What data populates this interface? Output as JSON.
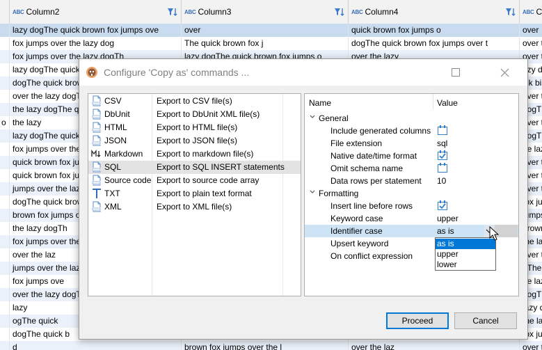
{
  "grid": {
    "columns": [
      {
        "name": "Column2",
        "type_badge": "ABC"
      },
      {
        "name": "Column3",
        "type_badge": "ABC"
      },
      {
        "name": "Column4",
        "type_badge": "ABC"
      },
      {
        "name": "C",
        "type_badge": "ABC"
      }
    ],
    "rows": [
      {
        "num": "",
        "c2": "lazy dogThe quick brown fox jumps ove",
        "c3": "over",
        "c4": "quick brown fox jumps o",
        "c5": "over"
      },
      {
        "num": "",
        "c2": "fox jumps over the lazy dog",
        "c3": "The quick brown fox j",
        "c4": "dogThe quick brown fox jumps over t",
        "c5": "over t"
      },
      {
        "num": "",
        "c2": "fox jumps over the lazy dogTh",
        "c3": "lazy dogThe quick brown fox jumps o",
        "c4": "over the lazy",
        "c5": "over t"
      },
      {
        "num": "",
        "c2": "lazy dogThe quick",
        "c3": "",
        "c4": "",
        "c5": "azy d"
      },
      {
        "num": "",
        "c2": "dogThe quick brow",
        "c3": "",
        "c4": "",
        "c5": "ick bi"
      },
      {
        "num": "",
        "c2": "over the lazy dogT",
        "c3": "",
        "c4": "",
        "c5": "over t"
      },
      {
        "num": "",
        "c2": "the lazy dogThe qu",
        "c3": "",
        "c4": "",
        "c5": "dogTh"
      },
      {
        "num": "o",
        "c2": "the lazy",
        "c3": "",
        "c4": "",
        "c5": "over t"
      },
      {
        "num": "",
        "c2": "lazy dogThe quick",
        "c3": "",
        "c4": "",
        "c5": "dogTh"
      },
      {
        "num": "",
        "c2": "fox jumps over the",
        "c3": "",
        "c4": "",
        "c5": "he laz"
      },
      {
        "num": "",
        "c2": "quick brown fox ju",
        "c3": "",
        "c4": "",
        "c5": "over t"
      },
      {
        "num": "",
        "c2": "quick brown fox ju",
        "c3": "",
        "c4": "",
        "c5": "over t"
      },
      {
        "num": "",
        "c2": "jumps over the laz",
        "c3": "",
        "c4": "",
        "c5": "over t"
      },
      {
        "num": "",
        "c2": "dogThe quick brow",
        "c3": "",
        "c4": "",
        "c5": "fox ju"
      },
      {
        "num": "",
        "c2": "brown fox jumps o",
        "c3": "",
        "c4": "",
        "c5": "jumps"
      },
      {
        "num": "",
        "c2": "the lazy dogTh",
        "c3": "",
        "c4": "",
        "c5": "brown"
      },
      {
        "num": "",
        "c2": "fox jumps over the",
        "c3": "",
        "c4": "",
        "c5": "the la"
      },
      {
        "num": "",
        "c2": "over the laz",
        "c3": "",
        "c4": "",
        "c5": "over t"
      },
      {
        "num": "",
        "c2": "jumps over the laz",
        "c3": "",
        "c4": "",
        "c5": "gThe"
      },
      {
        "num": "",
        "c2": "fox jumps ove",
        "c3": "",
        "c4": "",
        "c5": "he laz"
      },
      {
        "num": "",
        "c2": "over the lazy dogT",
        "c3": "",
        "c4": "",
        "c5": "dogTh"
      },
      {
        "num": "",
        "c2": "lazy",
        "c3": "",
        "c4": "",
        "c5": "lazy d"
      },
      {
        "num": "",
        "c2": "ogThe quick",
        "c3": "",
        "c4": "",
        "c5": "the la"
      },
      {
        "num": "",
        "c2": "dogThe quick b",
        "c3": "",
        "c4": "",
        "c5": "fox ju"
      },
      {
        "num": "",
        "c2": "d",
        "c3": "brown fox jumps over the l",
        "c4": "over the laz",
        "c5": "over t"
      }
    ]
  },
  "dialog": {
    "title": "Configure 'Copy as' commands ...",
    "formats": [
      {
        "name": "CSV",
        "desc": "Export to CSV file(s)",
        "icon": "csv-file-icon"
      },
      {
        "name": "DbUnit",
        "desc": "Export to DbUnit XML file(s)",
        "icon": "xml-file-icon"
      },
      {
        "name": "HTML",
        "desc": "Export to HTML file(s)",
        "icon": "html-file-icon"
      },
      {
        "name": "JSON",
        "desc": "Export to JSON file(s)",
        "icon": "json-file-icon"
      },
      {
        "name": "Markdown",
        "desc": "Export to markdown file(s)",
        "icon": "markdown-icon"
      },
      {
        "name": "SQL",
        "desc": "Export to SQL INSERT statements",
        "icon": "sql-file-icon"
      },
      {
        "name": "Source code",
        "desc": "Export to source code array",
        "icon": "code-file-icon"
      },
      {
        "name": "TXT",
        "desc": "Export to plain text format",
        "icon": "text-icon"
      },
      {
        "name": "XML",
        "desc": "Export to XML file(s)",
        "icon": "xml-file-icon"
      }
    ],
    "selected_format": "SQL",
    "properties": {
      "header_name": "Name",
      "header_value": "Value",
      "general_label": "General",
      "general": [
        {
          "name": "Include generated columns",
          "type": "checkbox",
          "checked": false
        },
        {
          "name": "File extension",
          "type": "text",
          "value": "sql"
        },
        {
          "name": "Native date/time format",
          "type": "checkbox",
          "checked": true
        },
        {
          "name": "Omit schema name",
          "type": "checkbox",
          "checked": false
        },
        {
          "name": "Data rows per statement",
          "type": "text",
          "value": "10"
        }
      ],
      "formatting_label": "Formatting",
      "formatting": [
        {
          "name": "Insert line before rows",
          "type": "checkbox",
          "checked": true
        },
        {
          "name": "Keyword case",
          "type": "text",
          "value": "upper"
        },
        {
          "name": "Identifier case",
          "type": "combo",
          "value": "as is"
        },
        {
          "name": "Upsert keyword",
          "type": "text",
          "value": ""
        },
        {
          "name": "On conflict expression",
          "type": "text",
          "value": ""
        }
      ]
    },
    "dropdown_options": [
      "as is",
      "upper",
      "lower"
    ],
    "dropdown_selected": "as is",
    "proceed_label": "Proceed",
    "cancel_label": "Cancel"
  },
  "colors": {
    "accent": "#0078d7",
    "row_shade": "#eaf1fa",
    "row_selected": "#c9dbef",
    "checkbox_blue": "#2f7fd0"
  }
}
